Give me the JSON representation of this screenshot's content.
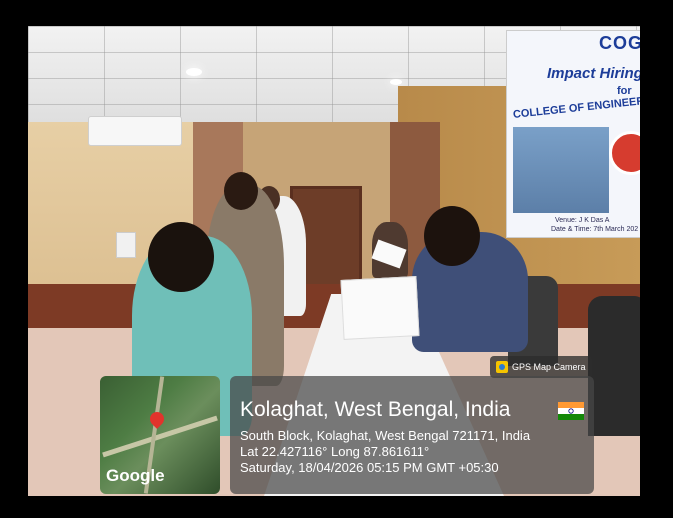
{
  "photo": {
    "banner": {
      "logo_text": "COG",
      "title": "Impact Hiring",
      "for_text": "for",
      "college_text": "COLLEGE OF ENGINEERING AND",
      "venue_text": "Venue: J K Das A",
      "date_text": "Date & Time: 7th March 202"
    }
  },
  "overlay": {
    "map_brand": "Google",
    "app_label": "GPS Map Camera",
    "location_title": "Kolaghat, West Bengal, India",
    "address": "South Block, Kolaghat, West Bengal 721171, India",
    "coordinates": "Lat 22.427116° Long 87.861611°",
    "datetime": "Saturday, 18/04/2026 05:15 PM GMT +05:30",
    "flag_icon": "india-flag-icon"
  }
}
